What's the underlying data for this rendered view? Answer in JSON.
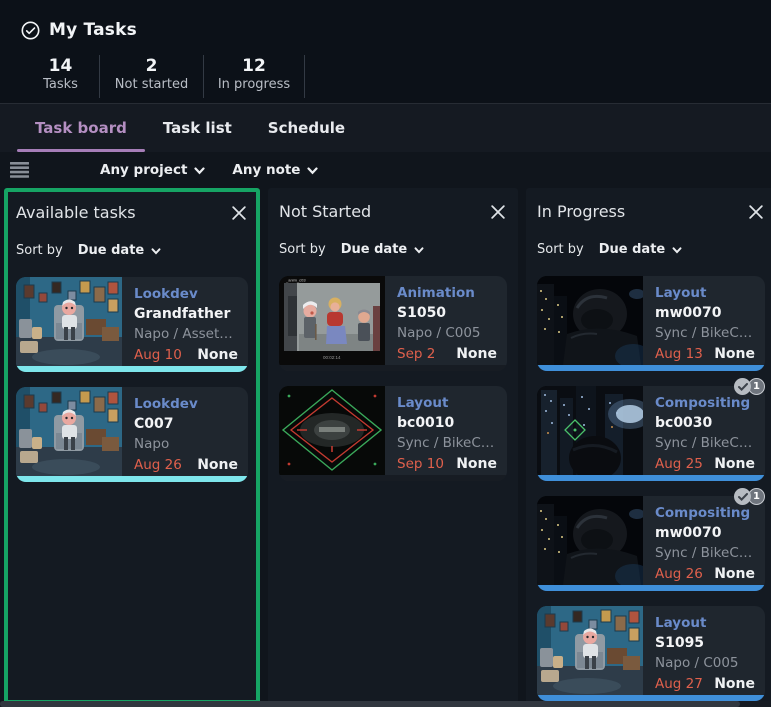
{
  "header": {
    "title": "My Tasks",
    "stats": [
      {
        "value": "14",
        "label": "Tasks"
      },
      {
        "value": "2",
        "label": "Not started"
      },
      {
        "value": "12",
        "label": "In progress"
      }
    ]
  },
  "tabs": [
    {
      "label": "Task board",
      "active": true
    },
    {
      "label": "Task list",
      "active": false
    },
    {
      "label": "Schedule",
      "active": false
    }
  ],
  "filters": {
    "project_filter": "Any project",
    "note_filter": "Any note"
  },
  "board": {
    "columns": [
      {
        "title": "Available tasks",
        "highlighted": true,
        "sort_label": "Sort by",
        "sort_value": "Due date",
        "cards": [
          {
            "task_type": "Lookdev",
            "entity": "Grandfather",
            "path": "Napo / Asset_Builds",
            "due_date": "Aug 10",
            "priority": "None",
            "thumb": "grandfather-room",
            "strip_color": "#7ee6ec"
          },
          {
            "task_type": "Lookdev",
            "entity": "C007",
            "path": "Napo",
            "due_date": "Aug 26",
            "priority": "None",
            "thumb": "grandfather-room",
            "strip_color": "#7ee6ec"
          }
        ]
      },
      {
        "title": "Not Started",
        "highlighted": false,
        "sort_label": "Sort by",
        "sort_value": "Due date",
        "cards": [
          {
            "task_type": "Animation",
            "entity": "S1050",
            "path": "Napo / C005",
            "due_date": "Sep 2",
            "priority": "None",
            "thumb": "animation-playblast",
            "strip_color": "#171c23"
          },
          {
            "task_type": "Layout",
            "entity": "bc0010",
            "path": "Sync / BikeChase",
            "due_date": "Sep 10",
            "priority": "None",
            "thumb": "layout-overlay",
            "strip_color": "#171c23"
          }
        ]
      },
      {
        "title": "In Progress",
        "highlighted": false,
        "sort_label": "Sort by",
        "sort_value": "Due date",
        "cards": [
          {
            "task_type": "Layout",
            "entity": "mw0070",
            "path": "Sync / BikeChase",
            "due_date": "Aug 13",
            "priority": "None",
            "thumb": "biker-night",
            "strip_color": "#3f8fd9"
          },
          {
            "task_type": "Compositing",
            "entity": "bc0030",
            "path": "Sync / BikeChase",
            "due_date": "Aug 25",
            "priority": "None",
            "thumb": "city-reticle",
            "strip_color": "#3f8fd9",
            "badges": {
              "done": true,
              "count": "1"
            }
          },
          {
            "task_type": "Compositing",
            "entity": "mw0070",
            "path": "Sync / BikeChase",
            "due_date": "Aug 26",
            "priority": "None",
            "thumb": "biker-night",
            "strip_color": "#3f8fd9",
            "badges": {
              "done": true,
              "count": "1"
            }
          },
          {
            "task_type": "Layout",
            "entity": "S1095",
            "path": "Napo / C005",
            "due_date": "Aug 27",
            "priority": "None",
            "thumb": "grandfather-room",
            "strip_color": "#3f8fd9"
          }
        ]
      }
    ]
  },
  "thumb_overlays": {
    "animation-playblast": {
      "corner_label": "_anim_c03",
      "timecode": "00:02:14"
    }
  },
  "colors": {
    "highlight_border": "#16a464",
    "active_tab": "#b48fc2",
    "task_type_text": "#6a8bca",
    "due_date_text": "#e0604c",
    "strip_available": "#7ee6ec",
    "strip_in_progress": "#3f8fd9"
  }
}
